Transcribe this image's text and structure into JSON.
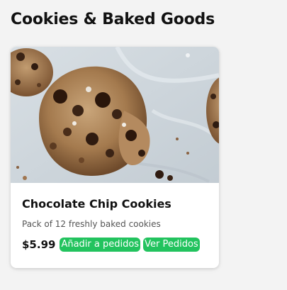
{
  "page": {
    "title": "Cookies & Baked Goods"
  },
  "product": {
    "image_alt": "Chocolate chip cookies",
    "name": "Chocolate Chip Cookies",
    "description": "Pack of 12 freshly baked cookies",
    "price": "$5.99",
    "add_button_label": "Añadir a pedidos",
    "view_button_label": "Ver Pedidos"
  },
  "colors": {
    "accent": "#22c35e",
    "card_background": "#ffffff",
    "page_background": "#f3f3f3"
  }
}
